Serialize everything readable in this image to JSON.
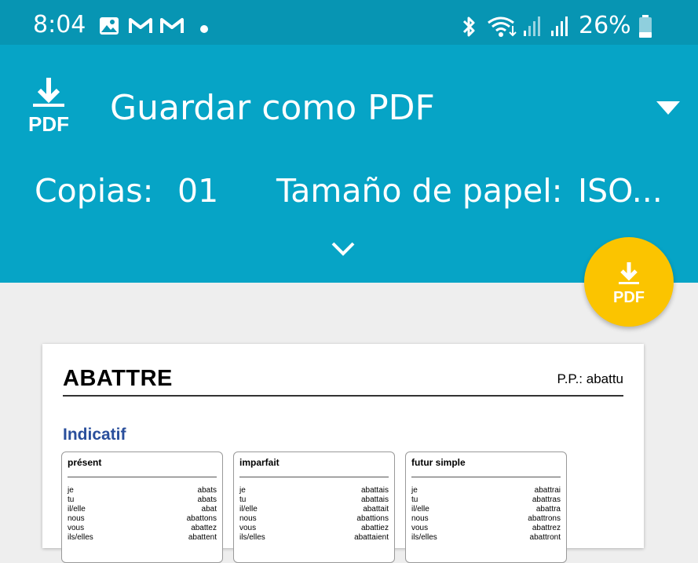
{
  "status_bar": {
    "time": "8:04",
    "battery_percent": "26%",
    "icons": [
      "gallery-icon",
      "gmail-icon",
      "gmail-icon",
      "notification-dot",
      "bluetooth-icon",
      "wifi-icon",
      "signal-icon",
      "signal-icon",
      "battery-icon"
    ]
  },
  "toolbar": {
    "destination_title": "Guardar como PDF",
    "copies_label": "Copias:",
    "copies_value": "01",
    "paper_size_label": "Tamaño de papel:",
    "paper_size_value": "ISO...",
    "icon_left": "pdf-download-icon",
    "icon_dropdown": "dropdown-arrow-icon",
    "icon_expand": "chevron-down-icon"
  },
  "fab": {
    "icon": "pdf-download-icon",
    "label": "PDF"
  },
  "colors": {
    "status_bar": "#0795b3",
    "toolbar": "#06a4c6",
    "fab": "#fbc400",
    "mood_heading": "#2a4f9c",
    "background": "#eeeeee"
  },
  "preview": {
    "verb": "ABATTRE",
    "past_participle": "P.P.: abattu",
    "mood": "Indicatif",
    "tenses": [
      {
        "name": "présent",
        "rows": [
          {
            "pronoun": "je",
            "form": "abats"
          },
          {
            "pronoun": "tu",
            "form": "abats"
          },
          {
            "pronoun": "il/elle",
            "form": "abat"
          },
          {
            "pronoun": "nous",
            "form": "abattons"
          },
          {
            "pronoun": "vous",
            "form": "abattez"
          },
          {
            "pronoun": "ils/elles",
            "form": "abattent"
          }
        ]
      },
      {
        "name": "imparfait",
        "rows": [
          {
            "pronoun": "je",
            "form": "abattais"
          },
          {
            "pronoun": "tu",
            "form": "abattais"
          },
          {
            "pronoun": "il/elle",
            "form": "abattait"
          },
          {
            "pronoun": "nous",
            "form": "abattions"
          },
          {
            "pronoun": "vous",
            "form": "abattiez"
          },
          {
            "pronoun": "ils/elles",
            "form": "abattaient"
          }
        ]
      },
      {
        "name": "futur simple",
        "rows": [
          {
            "pronoun": "je",
            "form": "abattrai"
          },
          {
            "pronoun": "tu",
            "form": "abattras"
          },
          {
            "pronoun": "il/elle",
            "form": "abattra"
          },
          {
            "pronoun": "nous",
            "form": "abattrons"
          },
          {
            "pronoun": "vous",
            "form": "abattrez"
          },
          {
            "pronoun": "ils/elles",
            "form": "abattront"
          }
        ]
      }
    ]
  }
}
